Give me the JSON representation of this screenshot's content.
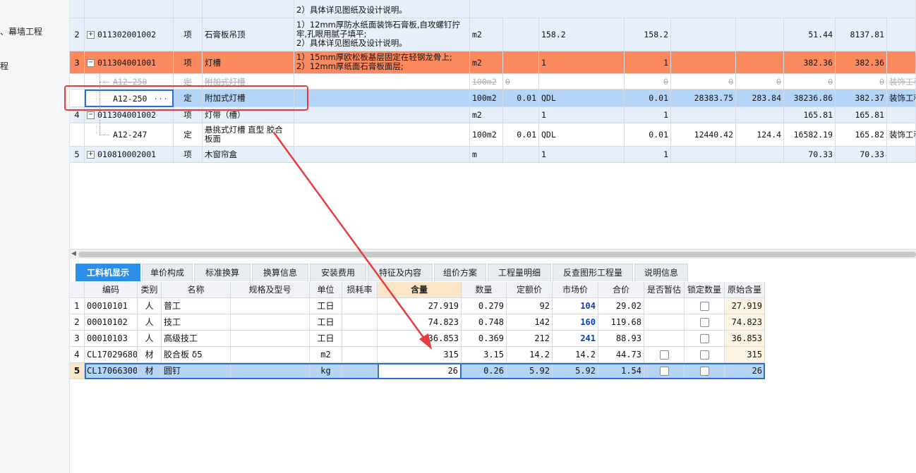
{
  "nav": {
    "items": [
      {
        "label": "壳、幕墙工程",
        "display": "、幕墙工程"
      },
      {
        "label": "程"
      }
    ]
  },
  "upper_rows": [
    {
      "desc_lines": [
        "2）具体详见图纸及设计说明。"
      ]
    },
    {
      "idx": "2",
      "code": "011302001002",
      "kind": "项",
      "name": "石膏板吊顶",
      "desc_lines": [
        "1）12mm厚防水纸面装饰石膏板,自攻螺钉拧",
        "牢,孔眼用腻子填平;",
        "2）具体详见图纸及设计说明。"
      ],
      "unit": "m2",
      "qty_expr": "158.2",
      "qty": "158.2",
      "unit_price": "51.44",
      "total": "8137.81"
    },
    {
      "idx": "3",
      "code": "011304001001",
      "kind": "项",
      "name": "灯槽",
      "desc_lines": [
        "1）15mm厚欧松板基层固定在轻钢龙骨上;",
        "2）12mm厚纸面石膏板面层;"
      ],
      "unit": "m2",
      "qty_expr": "1",
      "qty": "1",
      "unit_price": "382.36",
      "total": "382.36"
    },
    {
      "code": "A12-250",
      "kind": "定",
      "name": "附加式灯槽",
      "unit": "100m2",
      "content": "0",
      "v1": "0",
      "v2": "0",
      "v3": "0",
      "unit_price": "0",
      "total": "0",
      "major": "装饰工程"
    },
    {
      "code": "A12-250",
      "kind": "定",
      "name": "附加式灯槽",
      "unit": "100m2",
      "content": "0.01",
      "qty_expr": "QDL",
      "qty": "0.01",
      "v1": "28383.75",
      "v2": "283.84",
      "unit_price": "38236.86",
      "total": "382.37",
      "major": "装饰工程",
      "more": "···"
    },
    {
      "idx": "4",
      "code": "011304001002",
      "kind": "项",
      "name": "灯带（槽）",
      "unit": "m2",
      "qty_expr": "1",
      "qty": "1",
      "unit_price": "165.81",
      "total": "165.81"
    },
    {
      "code": "A12-247",
      "kind": "定",
      "name_lines": [
        "悬挑式灯槽 直型 胶合",
        "板面"
      ],
      "unit": "100m2",
      "content": "0.01",
      "qty_expr": "QDL",
      "qty": "0.01",
      "v1": "12440.42",
      "v2": "124.4",
      "unit_price": "16582.19",
      "total": "165.82",
      "major": "装饰工程"
    },
    {
      "idx": "5",
      "code": "010810002001",
      "kind": "项",
      "name": "木窗帘盒",
      "unit": "m",
      "qty_expr": "1",
      "qty": "1",
      "unit_price": "70.33",
      "total": "70.33"
    }
  ],
  "tabs": [
    {
      "label": "工料机显示",
      "active": true
    },
    {
      "label": "单价构成"
    },
    {
      "label": "标准换算"
    },
    {
      "label": "换算信息"
    },
    {
      "label": "安装费用"
    },
    {
      "label": "特征及内容"
    },
    {
      "label": "组价方案"
    },
    {
      "label": "工程量明细"
    },
    {
      "label": "反查图形工程量"
    },
    {
      "label": "说明信息"
    }
  ],
  "lower": {
    "headers": [
      "编码",
      "类别",
      "名称",
      "规格及型号",
      "单位",
      "损耗率",
      "含量",
      "数量",
      "定额价",
      "市场价",
      "合价",
      "是否暂估",
      "锁定数量",
      "原始含量"
    ],
    "rows": [
      {
        "idx": "1",
        "code": "00010101",
        "type": "人",
        "name": "普工",
        "spec": "",
        "unit": "工日",
        "loss": "",
        "content": "27.919",
        "qty": "0.279",
        "base": "92",
        "market": "104",
        "sum": "29.02",
        "original": "27.919"
      },
      {
        "idx": "2",
        "code": "00010102",
        "type": "人",
        "name": "技工",
        "spec": "",
        "unit": "工日",
        "loss": "",
        "content": "74.823",
        "qty": "0.748",
        "base": "142",
        "market": "160",
        "sum": "119.68",
        "original": "74.823"
      },
      {
        "idx": "3",
        "code": "00010103",
        "type": "人",
        "name": "高级技工",
        "spec": "",
        "unit": "工日",
        "loss": "",
        "content": "36.853",
        "qty": "0.369",
        "base": "212",
        "market": "241",
        "sum": "88.93",
        "original": "36.853"
      },
      {
        "idx": "4",
        "code": "CL17029680",
        "type": "材",
        "name": "胶合板 δ5",
        "spec": "",
        "unit": "m2",
        "loss": "",
        "content": "315",
        "qty": "3.15",
        "base": "14.2",
        "market": "14.2",
        "sum": "44.73",
        "original": "315"
      },
      {
        "idx": "5",
        "code": "CL17066300",
        "type": "材",
        "name": "圆钉",
        "spec": "",
        "unit": "kg",
        "loss": "",
        "content": "26",
        "qty": "0.26",
        "base": "5.92",
        "market": "5.92",
        "sum": "1.54",
        "original": "26"
      }
    ]
  },
  "colors": {
    "accent": "#2d8ee8",
    "highlight_row": "#fc8a5e",
    "selected_row": "#b4d4f8",
    "annotation": "#ea3b3b",
    "market_bold": "#0a3cc8"
  }
}
